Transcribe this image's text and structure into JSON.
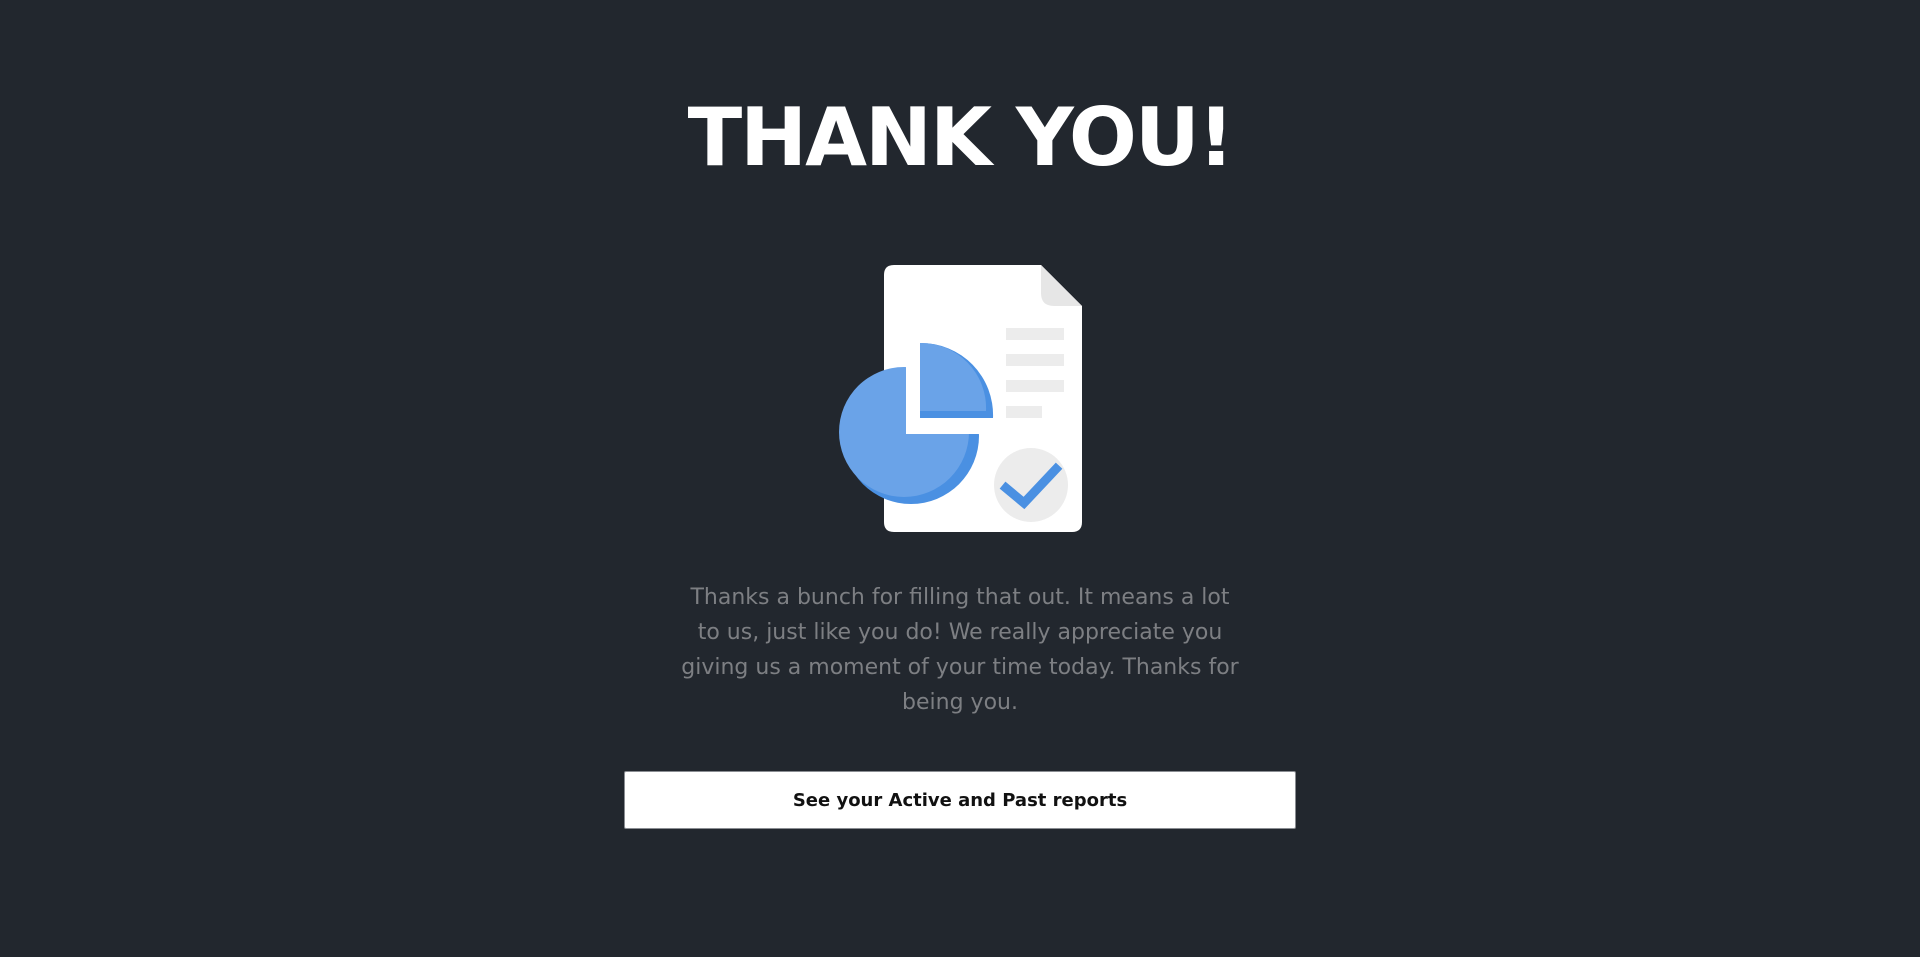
{
  "heading": {
    "title": "THANK YOU!"
  },
  "illustration": {
    "icon": "report-document-icon",
    "accent_color": "#4a90e2",
    "pie_color": "#6aa3e8",
    "doc_color": "#ffffff",
    "check_bg_color": "#ececec"
  },
  "message": {
    "text": "Thanks a bunch for filling that out. It means a lot to us, just like you do! We really appreciate you giving us a moment of your time today. Thanks for being you."
  },
  "actions": {
    "reports_button_label": "See your Active and Past reports"
  },
  "theme": {
    "background": "#22272e",
    "title_color": "#ffffff",
    "text_color": "#7d7f83"
  }
}
